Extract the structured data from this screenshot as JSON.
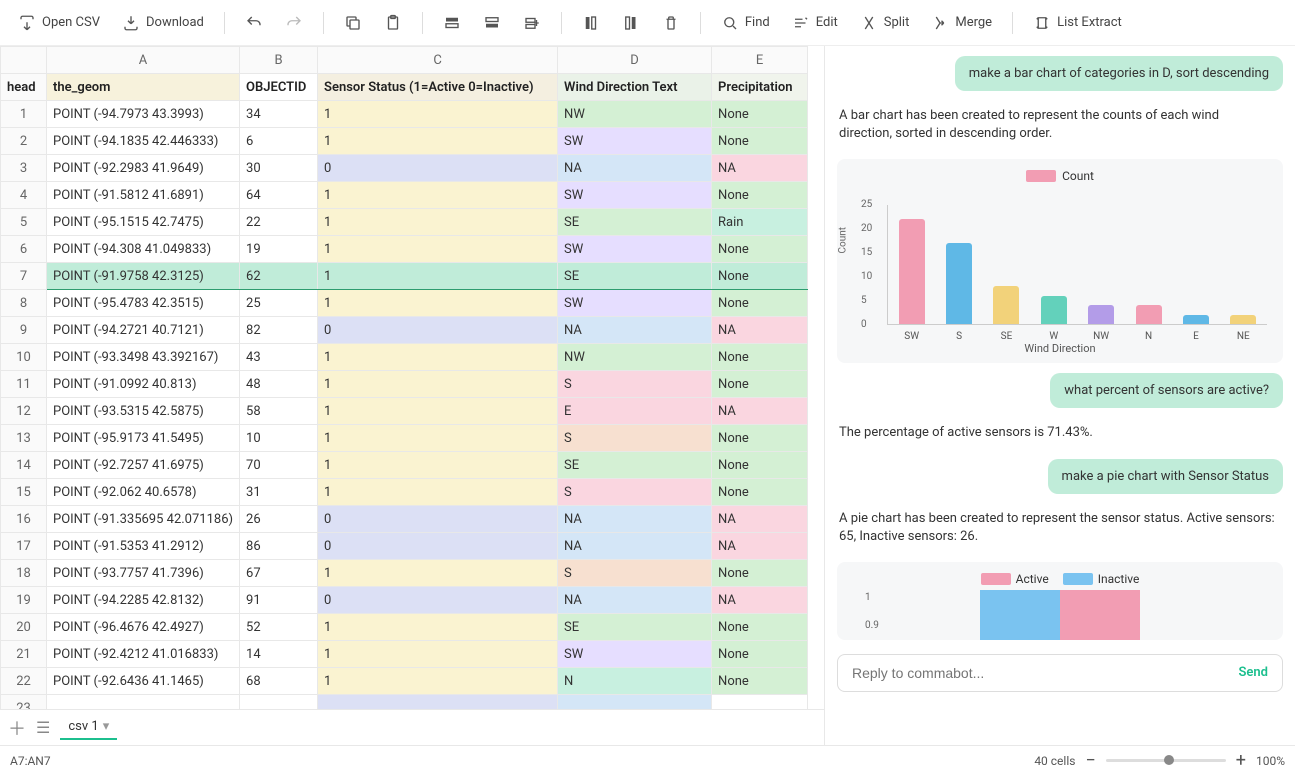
{
  "toolbar": {
    "open_csv": "Open CSV",
    "download": "Download",
    "find": "Find",
    "edit": "Edit",
    "split": "Split",
    "merge": "Merge",
    "list_extract": "List Extract"
  },
  "columns": [
    "A",
    "B",
    "C",
    "D",
    "E"
  ],
  "head_label": "head",
  "headers": {
    "A": "the_geom",
    "B": "OBJECTID",
    "C": "Sensor Status (1=Active 0=Inactive)",
    "D": "Wind Direction Text",
    "E": "Precipitation"
  },
  "rows": [
    {
      "n": 1,
      "geom": "POINT (-94.7973 43.3993)",
      "obj": "34",
      "status": "1",
      "sc": "c-yellow",
      "wind": "NW",
      "wc": "c-green",
      "precip": "None",
      "pc": "c-green"
    },
    {
      "n": 2,
      "geom": "POINT (-94.1835 42.446333)",
      "obj": "6",
      "status": "1",
      "sc": "c-yellow",
      "wind": "SW",
      "wc": "c-purple",
      "precip": "None",
      "pc": "c-green"
    },
    {
      "n": 3,
      "geom": "POINT (-92.2983 41.9649)",
      "obj": "30",
      "status": "0",
      "sc": "c-lav",
      "wind": "NA",
      "wc": "c-blue",
      "precip": "NA",
      "pc": "c-pink"
    },
    {
      "n": 4,
      "geom": "POINT (-91.5812 41.6891)",
      "obj": "64",
      "status": "1",
      "sc": "c-yellow",
      "wind": "SW",
      "wc": "c-purple",
      "precip": "None",
      "pc": "c-green"
    },
    {
      "n": 5,
      "geom": "POINT (-95.1515 42.7475)",
      "obj": "22",
      "status": "1",
      "sc": "c-yellow",
      "wind": "SE",
      "wc": "c-green",
      "precip": "Rain",
      "pc": "c-teal"
    },
    {
      "n": 6,
      "geom": "POINT (-94.308 41.049833)",
      "obj": "19",
      "status": "1",
      "sc": "c-yellow",
      "wind": "SW",
      "wc": "c-purple",
      "precip": "None",
      "pc": "c-green"
    },
    {
      "n": 7,
      "geom": "POINT (-91.9758 42.3125)",
      "obj": "62",
      "status": "1",
      "sc": "c-green",
      "wind": "SE",
      "wc": "c-green",
      "precip": "None",
      "pc": "c-green",
      "sel": true
    },
    {
      "n": 8,
      "geom": "POINT (-95.4783 42.3515)",
      "obj": "25",
      "status": "1",
      "sc": "c-yellow",
      "wind": "SW",
      "wc": "c-purple",
      "precip": "None",
      "pc": "c-green"
    },
    {
      "n": 9,
      "geom": "POINT (-94.2721 40.7121)",
      "obj": "82",
      "status": "0",
      "sc": "c-lav",
      "wind": "NA",
      "wc": "c-blue",
      "precip": "NA",
      "pc": "c-pink"
    },
    {
      "n": 10,
      "geom": "POINT (-93.3498 43.392167)",
      "obj": "43",
      "status": "1",
      "sc": "c-yellow",
      "wind": "NW",
      "wc": "c-green",
      "precip": "None",
      "pc": "c-green"
    },
    {
      "n": 11,
      "geom": "POINT (-91.0992 40.813)",
      "obj": "48",
      "status": "1",
      "sc": "c-yellow",
      "wind": "S",
      "wc": "c-pink",
      "precip": "None",
      "pc": "c-green"
    },
    {
      "n": 12,
      "geom": "POINT (-93.5315 42.5875)",
      "obj": "58",
      "status": "1",
      "sc": "c-yellow",
      "wind": "E",
      "wc": "c-pink",
      "precip": "NA",
      "pc": "c-pink"
    },
    {
      "n": 13,
      "geom": "POINT (-95.9173 41.5495)",
      "obj": "10",
      "status": "1",
      "sc": "c-yellow",
      "wind": "S",
      "wc": "c-peach",
      "precip": "None",
      "pc": "c-green"
    },
    {
      "n": 14,
      "geom": "POINT (-92.7257 41.6975)",
      "obj": "70",
      "status": "1",
      "sc": "c-yellow",
      "wind": "SE",
      "wc": "c-green",
      "precip": "None",
      "pc": "c-green"
    },
    {
      "n": 15,
      "geom": "POINT (-92.062 40.6578)",
      "obj": "31",
      "status": "1",
      "sc": "c-yellow",
      "wind": "S",
      "wc": "c-pink",
      "precip": "None",
      "pc": "c-green"
    },
    {
      "n": 16,
      "geom": "POINT (-91.335695 42.071186)",
      "obj": "26",
      "status": "0",
      "sc": "c-lav",
      "wind": "NA",
      "wc": "c-blue",
      "precip": "NA",
      "pc": "c-pink"
    },
    {
      "n": 17,
      "geom": "POINT (-91.5353 41.2912)",
      "obj": "86",
      "status": "0",
      "sc": "c-lav",
      "wind": "NA",
      "wc": "c-blue",
      "precip": "NA",
      "pc": "c-pink"
    },
    {
      "n": 18,
      "geom": "POINT (-93.7757 41.7396)",
      "obj": "67",
      "status": "1",
      "sc": "c-yellow",
      "wind": "S",
      "wc": "c-peach",
      "precip": "None",
      "pc": "c-green"
    },
    {
      "n": 19,
      "geom": "POINT (-94.2285 42.8132)",
      "obj": "91",
      "status": "0",
      "sc": "c-lav",
      "wind": "NA",
      "wc": "c-blue",
      "precip": "NA",
      "pc": "c-pink"
    },
    {
      "n": 20,
      "geom": "POINT (-96.4676 42.4927)",
      "obj": "52",
      "status": "1",
      "sc": "c-yellow",
      "wind": "SE",
      "wc": "c-green",
      "precip": "None",
      "pc": "c-green"
    },
    {
      "n": 21,
      "geom": "POINT (-92.4212 41.016833)",
      "obj": "14",
      "status": "1",
      "sc": "c-yellow",
      "wind": "SW",
      "wc": "c-purple",
      "precip": "None",
      "pc": "c-green"
    },
    {
      "n": 22,
      "geom": "POINT (-92.6436 41.1465)",
      "obj": "68",
      "status": "1",
      "sc": "c-yellow",
      "wind": "N",
      "wc": "c-teal",
      "precip": "None",
      "pc": "c-green"
    }
  ],
  "extra_row": "23",
  "tab_name": "csv 1",
  "chat": {
    "u1": "make a bar chart of categories in D, sort descending",
    "a1": "A bar chart has been created to represent the counts of each wind direction, sorted in descending order.",
    "u2": "what percent of sensors are active?",
    "a2": "The percentage of active sensors is 71.43%.",
    "u3": "make a pie chart with Sensor Status",
    "a3": "A pie chart has been created to represent the sensor status. Active sensors: 65, Inactive sensors: 26.",
    "placeholder": "Reply to commabot...",
    "send": "Send"
  },
  "chart_data": {
    "type": "bar",
    "title": "",
    "legend": "Count",
    "xlabel": "Wind Direction",
    "ylabel": "Count",
    "ylim": [
      0,
      25
    ],
    "yticks": [
      0,
      5,
      10,
      15,
      20,
      25
    ],
    "categories": [
      "SW",
      "S",
      "SE",
      "W",
      "NW",
      "N",
      "E",
      "NE"
    ],
    "values": [
      22,
      17,
      8,
      6,
      4,
      4,
      2,
      2
    ],
    "colors": [
      "#f29db3",
      "#5fb8e6",
      "#f2d27a",
      "#63d1bb",
      "#b39ce8",
      "#f29db3",
      "#5fb8e6",
      "#f2d27a"
    ]
  },
  "pie": {
    "legend": [
      "Active",
      "Inactive"
    ],
    "yticks": [
      "1",
      "0.9"
    ]
  },
  "status": {
    "cell": "A7:AN7",
    "cells": "40 cells",
    "zoom": "100%"
  }
}
